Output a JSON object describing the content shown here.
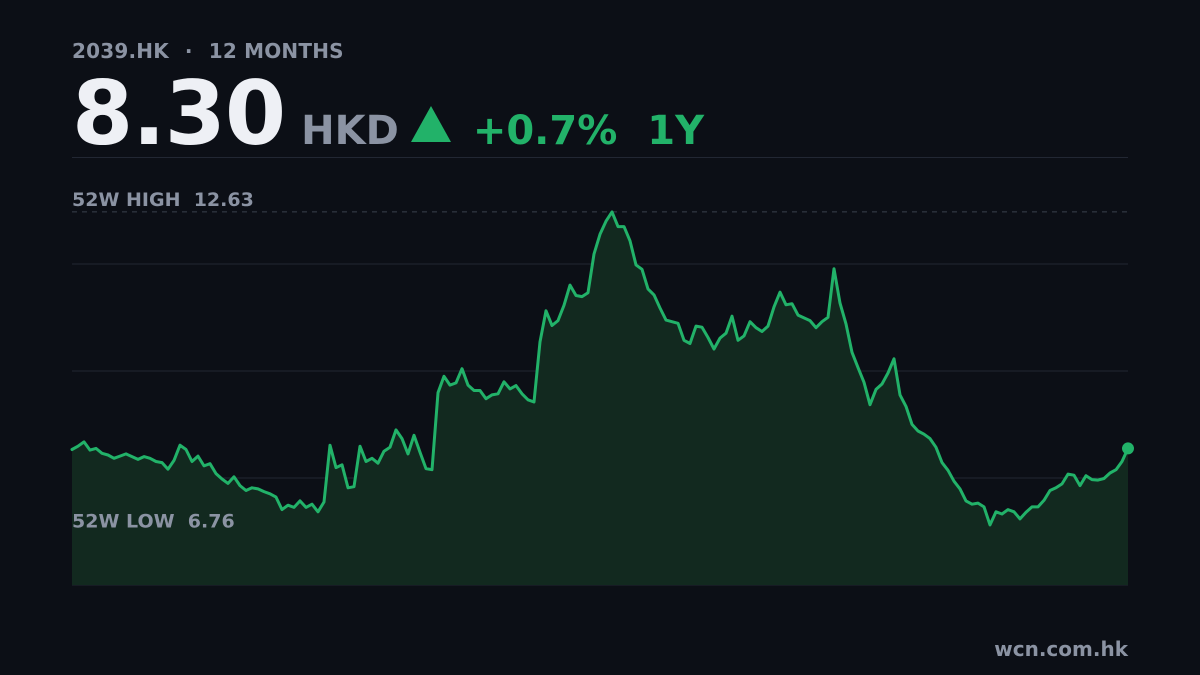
{
  "header": {
    "ticker": "2039.HK",
    "separator": "·",
    "period_label": "12 MONTHS",
    "price": "8.30",
    "currency": "HKD",
    "direction_icon": "triangle-up-icon",
    "change": "+0.7%",
    "change_period": "1Y"
  },
  "colors": {
    "background": "#0c0f16",
    "accent": "#22b269",
    "muted_text": "#8b93a3",
    "price_text": "#eef0f5",
    "area_fill": "#12291f",
    "gridline": "#222733"
  },
  "chart_data": {
    "type": "area",
    "title": "",
    "xlabel": "",
    "ylabel": "",
    "grid": true,
    "ylim": [
      5.8,
      13.58
    ],
    "high": {
      "label": "52W HIGH",
      "value": 12.63,
      "text": "12.63"
    },
    "low": {
      "label": "52W LOW",
      "value": 6.76,
      "text": "6.76"
    },
    "series": [
      {
        "values": [
          8.28,
          8.34,
          8.42,
          8.27,
          8.3,
          8.21,
          8.18,
          8.12,
          8.16,
          8.2,
          8.15,
          8.1,
          8.15,
          8.12,
          8.06,
          8.04,
          7.92,
          8.08,
          8.36,
          8.28,
          8.06,
          8.16,
          7.98,
          8.02,
          7.84,
          7.74,
          7.66,
          7.78,
          7.62,
          7.53,
          7.58,
          7.56,
          7.51,
          7.47,
          7.41,
          7.18,
          7.26,
          7.22,
          7.34,
          7.22,
          7.28,
          7.14,
          7.32,
          8.36,
          7.95,
          8.0,
          7.58,
          7.6,
          8.34,
          8.06,
          8.12,
          8.03,
          8.25,
          8.32,
          8.64,
          8.48,
          8.2,
          8.54,
          8.23,
          7.93,
          7.91,
          9.32,
          9.62,
          9.46,
          9.5,
          9.76,
          9.46,
          9.36,
          9.36,
          9.21,
          9.28,
          9.3,
          9.52,
          9.39,
          9.45,
          9.3,
          9.19,
          9.15,
          10.25,
          10.82,
          10.55,
          10.64,
          10.92,
          11.29,
          11.1,
          11.08,
          11.15,
          11.86,
          12.22,
          12.46,
          12.63,
          12.36,
          12.36,
          12.1,
          11.66,
          11.58,
          11.22,
          11.11,
          10.87,
          10.65,
          10.62,
          10.59,
          10.28,
          10.22,
          10.54,
          10.52,
          10.33,
          10.12,
          10.32,
          10.41,
          10.72,
          10.28,
          10.36,
          10.62,
          10.51,
          10.44,
          10.54,
          10.89,
          11.16,
          10.93,
          10.95,
          10.74,
          10.69,
          10.64,
          10.51,
          10.62,
          10.7,
          11.59,
          10.96,
          10.58,
          10.06,
          9.78,
          9.51,
          9.1,
          9.38,
          9.48,
          9.68,
          9.94,
          9.28,
          9.07,
          8.74,
          8.62,
          8.56,
          8.48,
          8.32,
          8.04,
          7.9,
          7.7,
          7.56,
          7.34,
          7.28,
          7.3,
          7.23,
          6.9,
          7.14,
          7.1,
          7.18,
          7.14,
          7.01,
          7.13,
          7.23,
          7.23,
          7.35,
          7.53,
          7.58,
          7.65,
          7.83,
          7.81,
          7.62,
          7.8,
          7.73,
          7.72,
          7.75,
          7.85,
          7.91,
          8.06,
          8.3
        ]
      }
    ]
  },
  "source": "wcn.com.hk"
}
